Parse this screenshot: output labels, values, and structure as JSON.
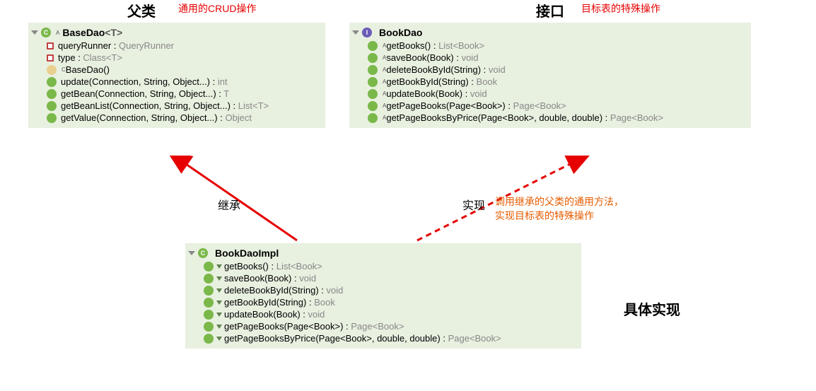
{
  "headers": {
    "parent_class": "父类",
    "parent_note": "通用的CRUD操作",
    "interface": "接口",
    "interface_note": "目标表的特殊操作"
  },
  "baseDao": {
    "name": "BaseDao",
    "typeParam": "<T>",
    "supA": "A",
    "fields": [
      {
        "name": "queryRunner",
        "type": "QueryRunner"
      },
      {
        "name": "type",
        "type": "Class<T>"
      }
    ],
    "constructor": {
      "name": "BaseDao()",
      "supC": "C"
    },
    "methods": [
      {
        "sig": "update(Connection, String, Object...)",
        "ret": "int"
      },
      {
        "sig": "getBean(Connection, String, Object...)",
        "ret": "T"
      },
      {
        "sig": "getBeanList(Connection, String, Object...)",
        "ret": "List<T>"
      },
      {
        "sig": "getValue(Connection, String, Object...)",
        "ret": "Object"
      }
    ]
  },
  "bookDao": {
    "name": "BookDao",
    "supA": "A",
    "methods": [
      {
        "sig": "getBooks()",
        "ret": "List<Book>"
      },
      {
        "sig": "saveBook(Book)",
        "ret": "void"
      },
      {
        "sig": "deleteBookById(String)",
        "ret": "void"
      },
      {
        "sig": "getBookById(String)",
        "ret": "Book"
      },
      {
        "sig": "updateBook(Book)",
        "ret": "void"
      },
      {
        "sig": "getPageBooks(Page<Book>)",
        "ret": "Page<Book>"
      },
      {
        "sig": "getPageBooksByPrice(Page<Book>, double, double)",
        "ret": "Page<Book>"
      }
    ]
  },
  "bookDaoImpl": {
    "name": "BookDaoImpl",
    "methods": [
      {
        "sig": "getBooks()",
        "ret": "List<Book>"
      },
      {
        "sig": "saveBook(Book)",
        "ret": "void"
      },
      {
        "sig": "deleteBookById(String)",
        "ret": "void"
      },
      {
        "sig": "getBookById(String)",
        "ret": "Book"
      },
      {
        "sig": "updateBook(Book)",
        "ret": "void"
      },
      {
        "sig": "getPageBooks(Page<Book>)",
        "ret": "Page<Book>"
      },
      {
        "sig": "getPageBooksByPrice(Page<Book>, double, double)",
        "ret": "Page<Book>"
      }
    ]
  },
  "relations": {
    "inherit": "继承",
    "implement": "实现",
    "implement_note_l1": "调用继承的父类的通用方法，",
    "implement_note_l2": "实现目标表的特殊操作"
  },
  "impl_label": "具体实现"
}
